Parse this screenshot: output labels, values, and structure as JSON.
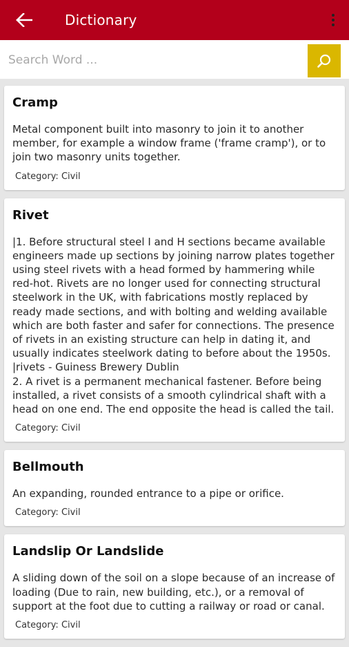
{
  "appbar": {
    "title": "Dictionary",
    "back_icon": "arrow-left-icon",
    "menu_icon": "more-vert-icon",
    "color": "#b3001b"
  },
  "search": {
    "placeholder": "Search Word ...",
    "value": "",
    "button_icon": "search-icon",
    "button_color": "#dab700"
  },
  "entries": [
    {
      "term": "Cramp",
      "definition": "Metal component built into masonry to join it to another member, for example a window frame ('frame cramp'), or to join two masonry units together.",
      "category": "Category: Civil"
    },
    {
      "term": "Rivet",
      "definition": "|1. Before structural steel I and H sections became available engineers made up sections by joining narrow plates together using steel rivets with a head formed by hammering while red-hot. Rivets are no longer used for connecting structural steelwork in the UK, with fabrications mostly replaced by ready made sections, and with bolting and welding available which are both faster and safer for connections. The presence of rivets in an existing structure can help in dating it, and usually indicates steelwork dating to before about the 1950s. |rivets - Guiness Brewery Dublin\n2. A rivet is a permanent mechanical fastener. Before being installed, a rivet consists of a smooth cylindrical shaft with a head on one end. The end opposite the head is called the tail.",
      "category": "Category: Civil"
    },
    {
      "term": "Bellmouth",
      "definition": "An expanding, rounded entrance to a pipe or orifice.",
      "category": "Category: Civil"
    },
    {
      "term": "Landslip Or Landslide",
      "definition": "A sliding down of the soil on a slope because of an increase of loading (Due to rain, new building, etc.), or a removal of support at the foot due to cutting a railway or road or canal.",
      "category": "Category: Civil"
    }
  ]
}
